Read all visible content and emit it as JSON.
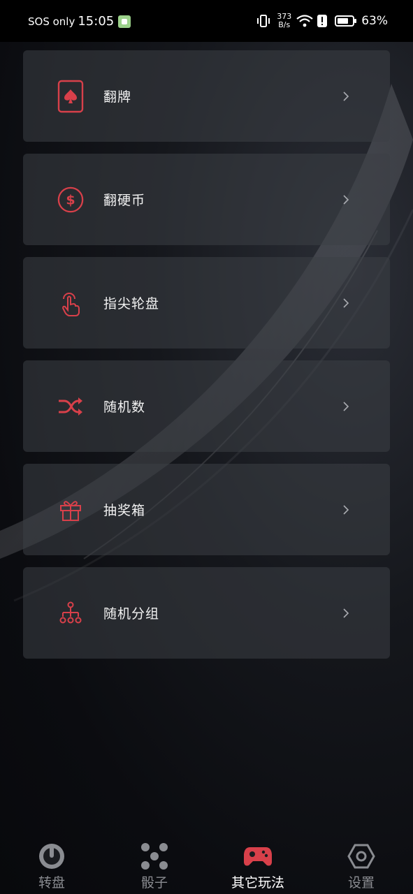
{
  "status_bar": {
    "carrier": "SOS only",
    "time": "15:05",
    "net_speed_value": "373",
    "net_speed_unit": "B/s",
    "battery_percent": "63%"
  },
  "menu": {
    "items": [
      {
        "label": "翻牌",
        "icon": "card-icon"
      },
      {
        "label": "翻硬币",
        "icon": "coin-icon"
      },
      {
        "label": "指尖轮盘",
        "icon": "finger-tap-icon"
      },
      {
        "label": "随机数",
        "icon": "shuffle-icon"
      },
      {
        "label": "抽奖箱",
        "icon": "gift-icon"
      },
      {
        "label": "随机分组",
        "icon": "group-tree-icon"
      }
    ]
  },
  "bottom_nav": {
    "items": [
      {
        "label": "转盘",
        "icon": "wheel-icon",
        "active": false
      },
      {
        "label": "骰子",
        "icon": "dice-icon",
        "active": false
      },
      {
        "label": "其它玩法",
        "icon": "gamepad-icon",
        "active": true
      },
      {
        "label": "设置",
        "icon": "hexagon-settings-icon",
        "active": false
      }
    ]
  },
  "colors": {
    "accent": "#d8404a",
    "nav_inactive": "#8a8c91",
    "card_bg": "#2f3238"
  }
}
